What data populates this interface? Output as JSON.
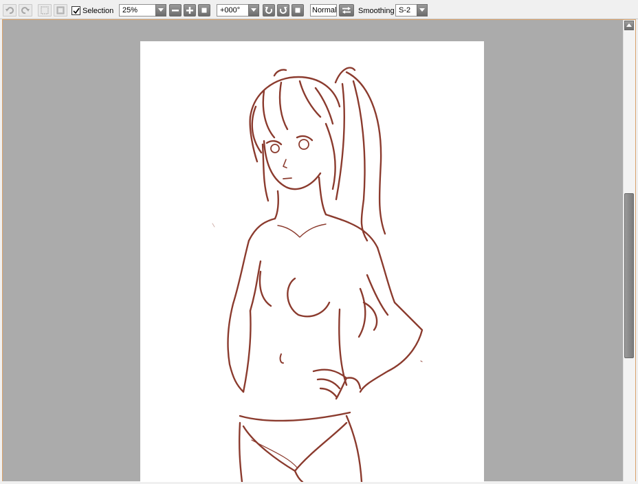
{
  "toolbar": {
    "selection_label": "Selection",
    "selection_checked": true,
    "zoom_value": "25%",
    "rotation_value": "+000°",
    "blend_mode": "Normal",
    "smoothing_label": "Smoothing",
    "smoothing_value": "S-2",
    "icons": [
      "undo-icon",
      "redo-icon",
      "deselect-icon",
      "invert-selection-icon",
      "zoom-out-icon",
      "zoom-in-icon",
      "zoom-reset-icon",
      "rotate-ccw-icon",
      "rotate-cw-icon",
      "rotate-reset-icon",
      "flip-horizontal-icon"
    ]
  },
  "canvas": {
    "background_color": "#ababab",
    "paper_color": "#ffffff",
    "stroke_color": "#8b3b2e",
    "content": "line-art-sketch-figure"
  },
  "scrollbar": {
    "position_fraction": 0.38
  }
}
